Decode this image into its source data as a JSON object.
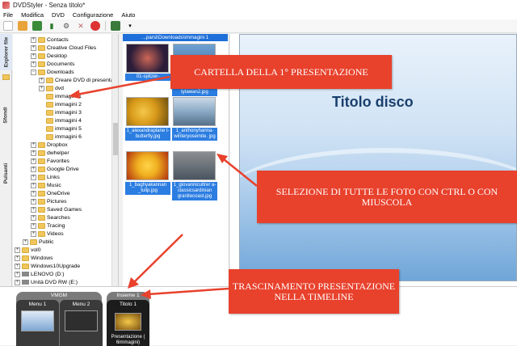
{
  "window": {
    "title": "DVDStyler - Senza titolo*"
  },
  "menu": [
    "File",
    "Modifica",
    "DVD",
    "Configurazione",
    "Aiuto"
  ],
  "side_tabs": [
    "Explorer file",
    "Sfondi",
    "Pulsanti"
  ],
  "tree": [
    "Contacts",
    "Creative Cloud Files",
    "Desktop",
    "Documents",
    "Downloads",
    "Creare DVD di presentazi",
    "dvd",
    "immagini 1",
    "immagini 2",
    "immagini 3",
    "immagini 4",
    "immagini 5",
    "immagini 6",
    "Dropbox",
    "dwhelper",
    "Favorites",
    "Google Drive",
    "Links",
    "Music",
    "OneDrive",
    "Pictures",
    "Saved Games",
    "Searches",
    "Tracing",
    "Videos",
    "Public",
    "vol0",
    "Windows",
    "Windows10Upgrade",
    "LENOVO (D:)",
    "Unità DVD RW (E:)"
  ],
  "gallery": {
    "path": "...parsi\\Downloads\\immagini 1",
    "items": [
      "01-spitzer-",
      "tytawan2.jpg",
      "1_alexandraplane t-butterfly.jpg",
      "1_anthonyhanna- winteryosemite. jpg",
      "1_baghyakannan _tulip.jpg",
      "1_giovannicultrer a-classicsardinian granitecoast.jpg"
    ],
    "colors": [
      "#2b1d3a",
      "#3d6fa0",
      "#d99a1a",
      "#8aa9c4",
      "#f0b020",
      "#4a5560"
    ]
  },
  "preview": {
    "disc_title": "Titolo disco"
  },
  "timeline": {
    "vmgm_label": "VMGM",
    "menu1": "Menu 1",
    "menu2": "Menu 2",
    "set_label": "Insieme 1",
    "title1": "Titolo 1",
    "presentation": "Presentazione ( 6immagini)"
  },
  "notes": {
    "n1": "CARTELLA DELLA 1° PRESENTAZIONE",
    "n2": "SELEZIONE DI TUTTE LE FOTO CON CTRL O CON MIUSCOLA",
    "n3": "TRASCINAMENTO PRESENTAZIONE NELLA TIMELINE"
  },
  "colors": {
    "selection": "#2b7de1",
    "annotation": "#e8412c"
  }
}
